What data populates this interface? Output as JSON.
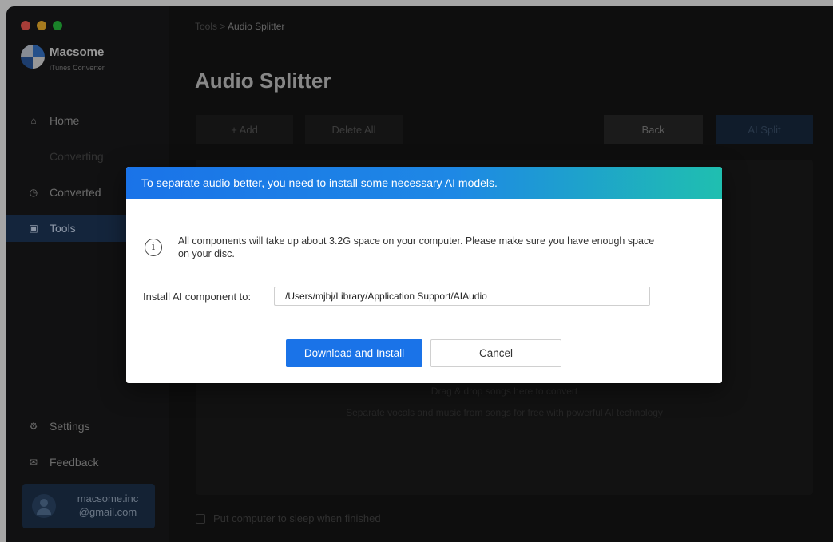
{
  "window": {
    "traffic_colors": [
      "#ff5f57",
      "#febc2e",
      "#28c840"
    ]
  },
  "sidebar": {
    "brand_name": "Macsome",
    "brand_subtitle": "iTunes Converter",
    "items": [
      {
        "label": "Home",
        "icon": "home-icon",
        "active": false
      },
      {
        "label": "Converting",
        "icon": "",
        "active": false
      },
      {
        "label": "Converted",
        "icon": "clock-icon",
        "active": false
      },
      {
        "label": "Tools",
        "icon": "toolbox-icon",
        "active": true
      }
    ],
    "bottom_items": [
      {
        "label": "Settings",
        "icon": "gear-icon"
      },
      {
        "label": "Feedback",
        "icon": "mail-icon"
      }
    ],
    "account": {
      "line1": "macsome.inc",
      "line2": "@gmail.com"
    }
  },
  "main": {
    "breadcrumb": {
      "parent": "Tools",
      "separator": ">",
      "current": "Audio Splitter"
    },
    "title": "Audio Splitter",
    "toolbar": {
      "add_label": "+ Add",
      "delete_label": "Delete All",
      "back_label": "Back",
      "split_label": "AI Split"
    },
    "dropzone": {
      "line1": "Drag & drop songs here to convert",
      "line2": "Separate vocals and music from songs for free with powerful AI technology"
    },
    "sleep_label": "Put computer to sleep when finished"
  },
  "dialog": {
    "header": "To separate audio better, you need to install some necessary AI models.",
    "info_icon_glyph": "i",
    "info_text": "All components will take up about 3.2G space on your computer. Please make sure you have enough space on your disc.",
    "path_label": "Install AI component to:",
    "path_value": "/Users/mjbj/Library/Application Support/AIAudio",
    "primary_button": "Download and Install",
    "secondary_button": "Cancel",
    "accent_color": "#1a73e8"
  }
}
